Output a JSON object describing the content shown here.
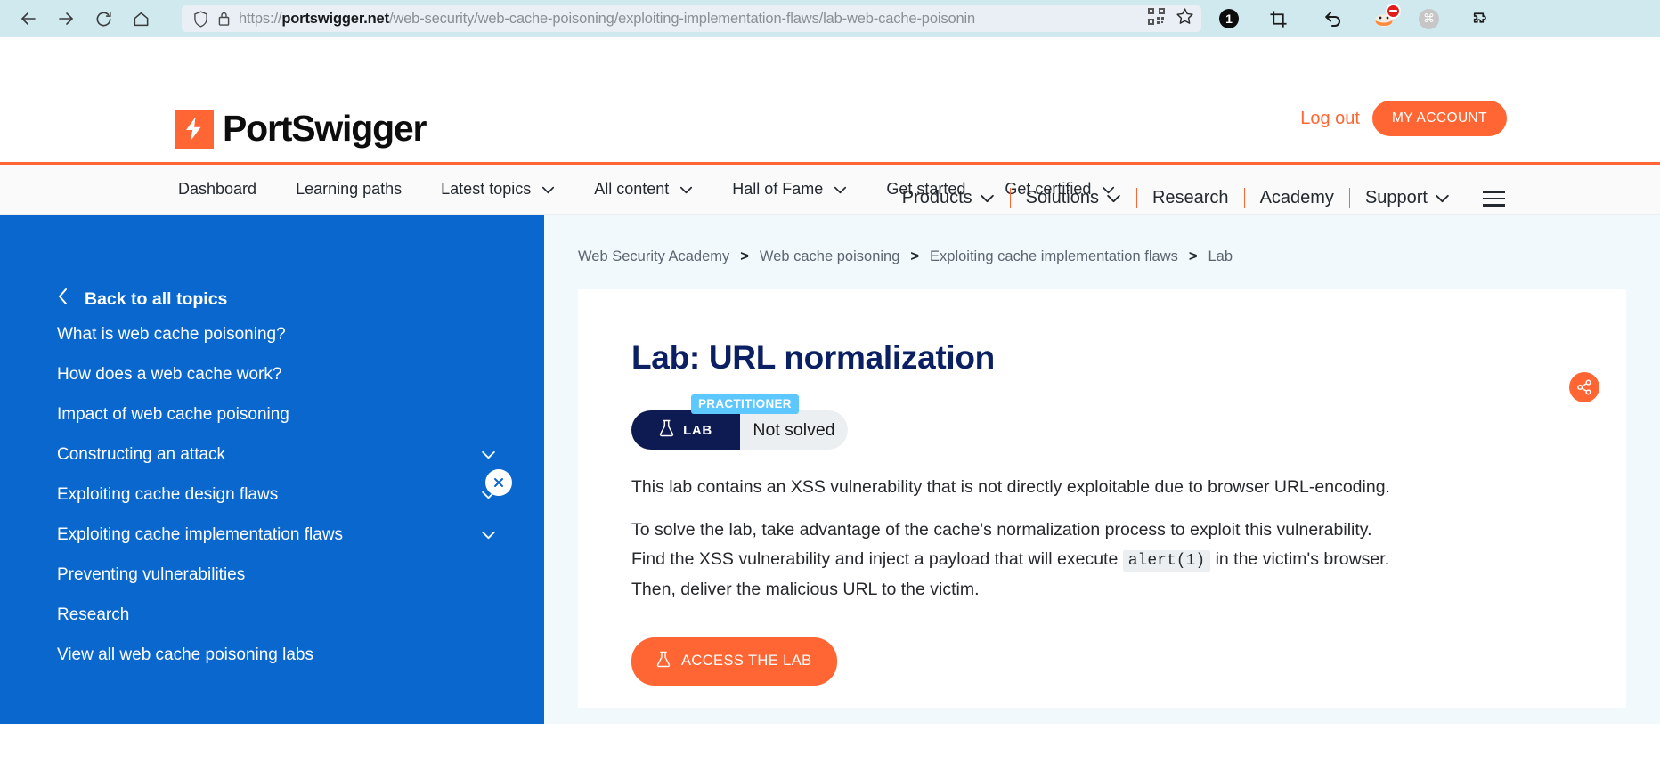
{
  "browser": {
    "back_label": "Back",
    "forward_label": "Forward",
    "reload_label": "Reload",
    "home_label": "Home",
    "url_scheme": "https://",
    "url_host": "portswigger.net",
    "url_path": "/web-security/web-cache-poisoning/exploiting-implementation-flaws/lab-web-cache-poisonin",
    "qr_label": "QR code",
    "bookmark_label": "Bookmark this page",
    "extension_count": "1",
    "screenshot_label": "Screenshot",
    "undo_label": "Undo",
    "ublock_label": "uBlock Origin",
    "grey_ext_label": "Extension",
    "puzzle_label": "Extensions"
  },
  "header": {
    "brand": "PortSwigger",
    "logout_label": "Log out",
    "my_account_label": "MY ACCOUNT",
    "nav": [
      {
        "label": "Products",
        "caret": true
      },
      {
        "label": "Solutions",
        "caret": true
      },
      {
        "label": "Research",
        "caret": false
      },
      {
        "label": "Academy",
        "caret": false
      },
      {
        "label": "Support",
        "caret": true
      }
    ]
  },
  "academy_nav": [
    {
      "label": "Dashboard",
      "caret": false
    },
    {
      "label": "Learning paths",
      "caret": false
    },
    {
      "label": "Latest topics",
      "caret": true
    },
    {
      "label": "All content",
      "caret": true
    },
    {
      "label": "Hall of Fame",
      "caret": true
    },
    {
      "label": "Get started",
      "caret": false
    },
    {
      "label": "Get certified",
      "caret": true
    }
  ],
  "sidebar": {
    "close_label": "Close",
    "back_label": "Back to all topics",
    "items": [
      {
        "label": "What is web cache poisoning?",
        "caret": false
      },
      {
        "label": "How does a web cache work?",
        "caret": false
      },
      {
        "label": "Impact of web cache poisoning",
        "caret": false
      },
      {
        "label": "Constructing an attack",
        "caret": true
      },
      {
        "label": "Exploiting cache design flaws",
        "caret": true
      },
      {
        "label": "Exploiting cache implementation flaws",
        "caret": true
      },
      {
        "label": "Preventing vulnerabilities",
        "caret": false
      },
      {
        "label": "Research",
        "caret": false
      },
      {
        "label": "View all web cache poisoning labs",
        "caret": false
      }
    ]
  },
  "breadcrumb": [
    "Web Security Academy",
    "Web cache poisoning",
    "Exploiting cache implementation flaws",
    "Lab"
  ],
  "breadcrumb_separator": ">",
  "lab": {
    "title": "Lab: URL normalization",
    "difficulty_badge": "PRACTITIONER",
    "pill_left_label": "LAB",
    "pill_right_label": "Not solved",
    "share_label": "Share",
    "paragraph_1": "This lab contains an XSS vulnerability that is not directly exploitable due to browser URL-encoding.",
    "paragraph_2_a": "To solve the lab, take advantage of the cache's normalization process to exploit this vulnerability. Find the XSS vulnerability and inject a payload that will execute ",
    "paragraph_2_code": "alert(1)",
    "paragraph_2_b": " in the victim's browser. Then, deliver the malicious URL to the victim.",
    "access_button_label": "ACCESS THE LAB"
  },
  "colors": {
    "brand_orange": "#ff6633",
    "sidebar_blue": "#0a67cd",
    "lab_navy": "#0d1b52",
    "practitioner_blue": "#5cc8ff",
    "title_navy": "#0b1f63",
    "chrome_bg": "#cfe9ef"
  }
}
